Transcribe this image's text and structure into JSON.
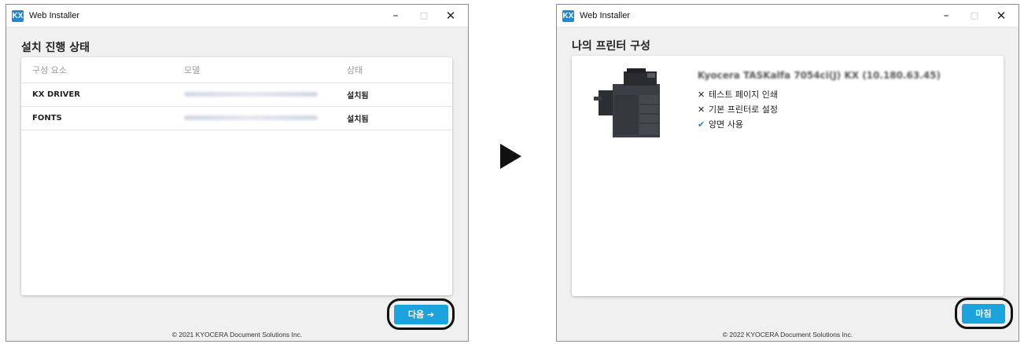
{
  "left_window": {
    "title": "Web Installer",
    "heading": "설치 진행 상태",
    "columns": [
      "구성 요소",
      "모델",
      "상태"
    ],
    "rows": [
      {
        "component": "KX DRIVER",
        "status": "설치됨"
      },
      {
        "component": "FONTS",
        "status": "설치됨"
      }
    ],
    "next_button": "다음 ➔",
    "footer": "© 2021 KYOCERA Document Solutions Inc."
  },
  "right_window": {
    "title": "Web Installer",
    "heading": "나의 프린터 구성",
    "printer_name": "Kyocera TASKalfa 7054ci(J) KX (10.180.63.45)",
    "options": [
      {
        "icon": "x-icon",
        "label": "테스트 페이지 인쇄"
      },
      {
        "icon": "x-icon",
        "label": "기본 프린터로 설정"
      },
      {
        "icon": "check-icon",
        "label": "양면 사용"
      }
    ],
    "finish_button": "마침",
    "footer": "© 2022 KYOCERA Document Solutions Inc."
  },
  "window_controls": {
    "minimize": "–",
    "maximize": "□",
    "close": "✕"
  },
  "app_icon_text": "KX",
  "colors": {
    "accent": "#1aa3dc",
    "highlight_ring": "#111111",
    "check": "#1a8ad6"
  }
}
